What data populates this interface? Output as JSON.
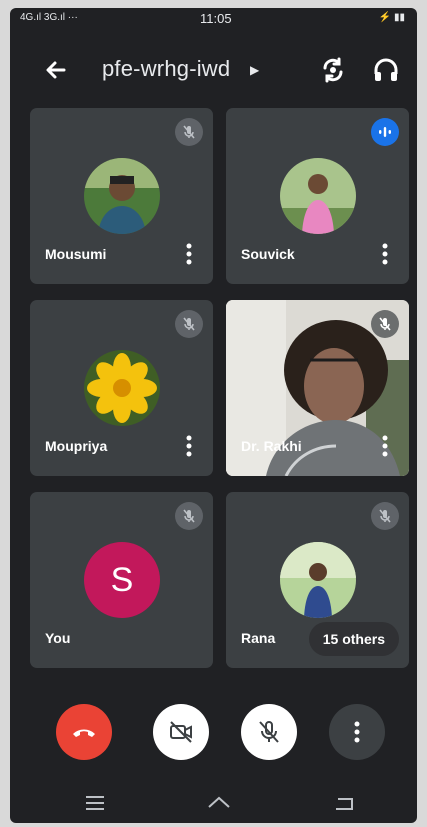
{
  "status": {
    "left": "4G.ıl 3G.ıl ···",
    "time": "11:05",
    "right": "⚡ ▮▮"
  },
  "header": {
    "room_code": "pfe-wrhg-iwd"
  },
  "participants": [
    {
      "name": "Mousumi"
    },
    {
      "name": "Souvick"
    },
    {
      "name": "Moupriya"
    },
    {
      "name": "Dr. Rakhi"
    },
    {
      "name": "You",
      "initial": "S"
    },
    {
      "name": "Rana"
    }
  ],
  "others_label": "15 others",
  "colors": {
    "end_call": "#ea4335",
    "speaking": "#1a73e8",
    "you_avatar": "#c2185b",
    "tile": "#3c4043"
  }
}
